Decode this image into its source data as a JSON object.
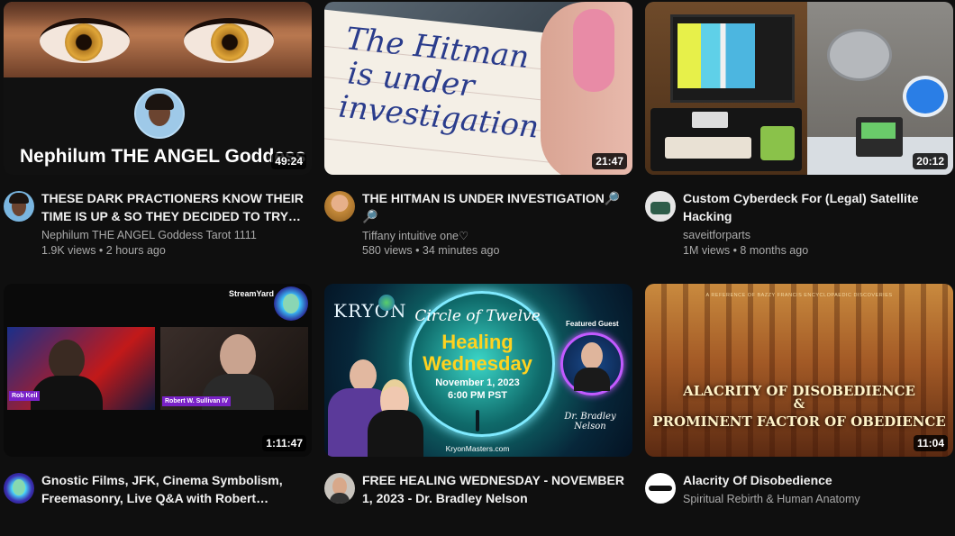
{
  "videos": [
    {
      "title": "THESE DARK PRACTIONERS KNOW THEIR TIME IS UP & SO THEY DECIDED TO TRY ON...",
      "channel": "Nephilum THE ANGEL Goddess Tarot 1111",
      "views": "1.9K views",
      "age": "2 hours ago",
      "duration": "49:24",
      "thumb_text": "Nephilum THE ANGEL Goddess"
    },
    {
      "title": "THE HITMAN IS UNDER INVESTIGATION🔎🔎",
      "channel": "Tiffany intuitive one♡",
      "views": "580 views",
      "age": "34 minutes ago",
      "duration": "21:47",
      "thumb_lines": [
        "The Hitman",
        "is under",
        "investigation"
      ]
    },
    {
      "title": "Custom Cyberdeck For (Legal) Satellite Hacking",
      "channel": "saveitforparts",
      "views": "1M views",
      "age": "8 months ago",
      "duration": "20:12"
    },
    {
      "title": "Gnostic Films, JFK, Cinema Symbolism, Freemasonry, Live Q&A with Robert Sullivan...",
      "duration": "1:11:47",
      "thumb_brand": "StreamYard",
      "guest_left": "Rob Keil",
      "guest_right": "Robert W. Sullivan IV"
    },
    {
      "title": "FREE HEALING WEDNESDAY - NOVEMBER 1, 2023 - Dr. Bradley Nelson",
      "thumb_logo": "KRYON",
      "thumb_heading": "Circle of Twelve",
      "thumb_main1": "Healing",
      "thumb_main2": "Wednesday",
      "thumb_date": "November 1, 2023",
      "thumb_time": "6:00 PM PST",
      "thumb_featured": "Featured Guest",
      "thumb_guest": "Dr. Bradley Nelson",
      "thumb_site": "KryonMasters.com"
    },
    {
      "title": "Alacrity Of Disobedience",
      "channel": "Spiritual Rebirth & Human Anatomy",
      "duration": "11:04",
      "thumb_banner": "A REFERENCE OF BAZZY FRANCIS ENCYCLOPAEDIC DISCOVERIES",
      "thumb_line1": "ALACRITY OF DISOBEDIENCE",
      "thumb_amp": "&",
      "thumb_line2": "PROMINENT FACTOR OF OBEDIENCE"
    }
  ]
}
